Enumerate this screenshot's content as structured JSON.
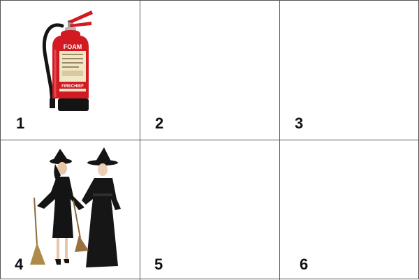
{
  "cells": [
    {
      "number": "1",
      "image": "fire-extinguisher",
      "label_top": "FOAM",
      "label_bottom": "FIRECHIEF"
    },
    {
      "number": "2",
      "image": ""
    },
    {
      "number": "3",
      "image": ""
    },
    {
      "number": "4",
      "image": "two-witches"
    },
    {
      "number": "5",
      "image": ""
    },
    {
      "number": "6",
      "image": ""
    }
  ],
  "colors": {
    "grid_line": "#555555",
    "number_text": "#111111",
    "extinguisher_red": "#d11a21",
    "label_cream": "#f2e7c4",
    "witch_black": "#141414",
    "broom": "#b08a4a"
  }
}
